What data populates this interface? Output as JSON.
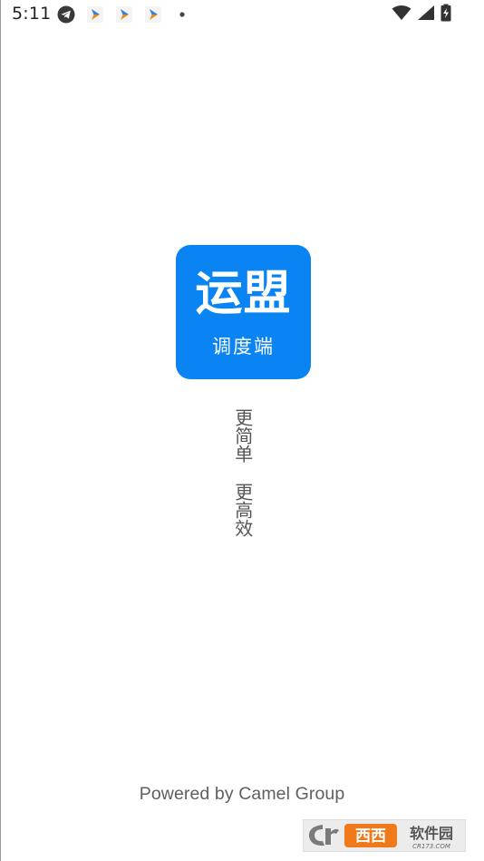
{
  "status_bar": {
    "time": "5:11",
    "notification_icons": [
      "telegram-icon",
      "app-arrow-icon",
      "app-arrow-icon",
      "app-arrow-icon",
      "dot-icon"
    ],
    "system_icons": [
      "wifi-icon",
      "signal-icon",
      "battery-charging-icon"
    ]
  },
  "logo": {
    "title": "运盟",
    "subtitle": "调度端",
    "background_color": "#0a84f3"
  },
  "slogan": {
    "line1": "更简单",
    "line2": "更高效"
  },
  "footer": {
    "powered_by": "Powered by Camel Group"
  },
  "watermark": {
    "text": "西西软件园",
    "subtext": "CR173.COM"
  }
}
